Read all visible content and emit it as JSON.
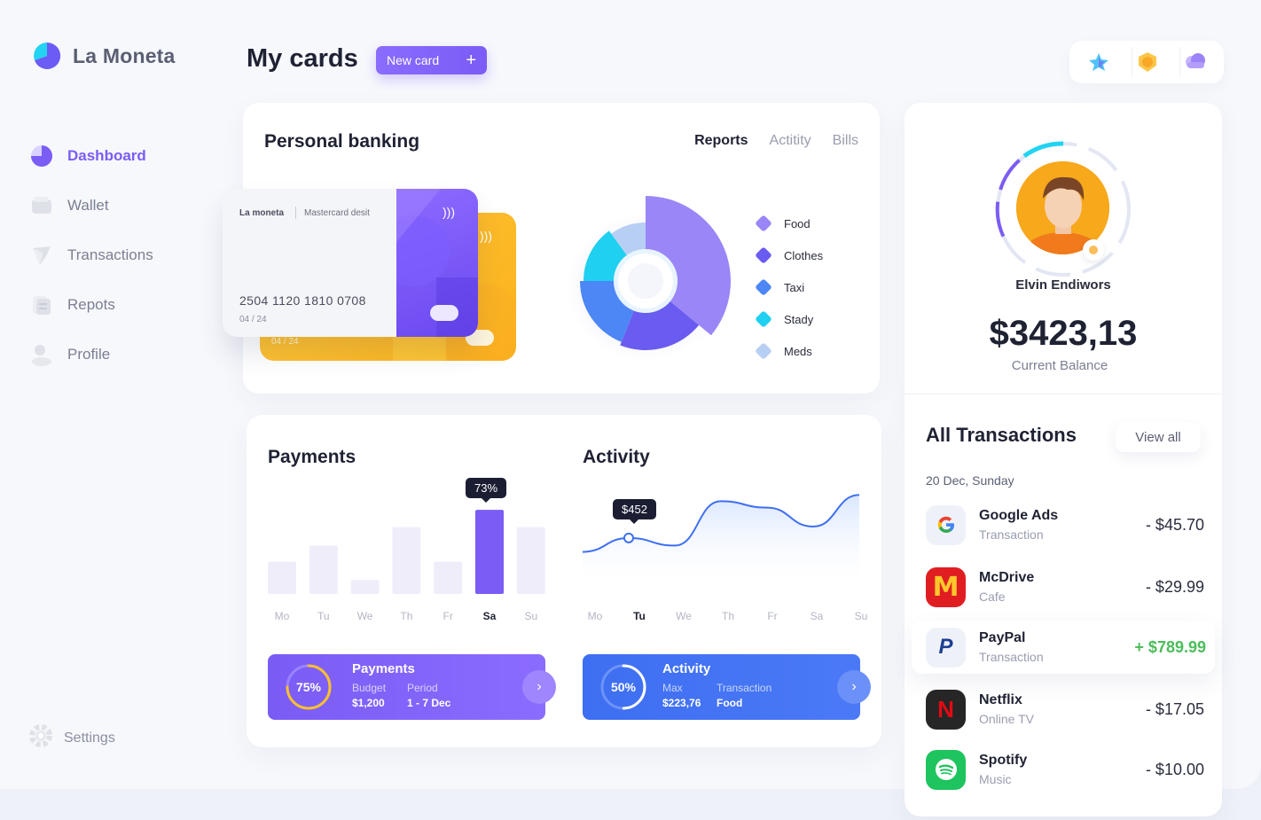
{
  "app": {
    "name": "La Moneta"
  },
  "sidebar": {
    "items": [
      {
        "label": "Dashboard",
        "icon": "pie-icon",
        "active": true
      },
      {
        "label": "Wallet",
        "icon": "wallet-icon"
      },
      {
        "label": "Transactions",
        "icon": "transactions-icon"
      },
      {
        "label": "Repots",
        "icon": "reports-icon"
      },
      {
        "label": "Profile",
        "icon": "profile-icon"
      }
    ],
    "settings_label": "Settings"
  },
  "header": {
    "title": "My cards",
    "new_card_label": "New card"
  },
  "top_icons": [
    "sparkle-icon",
    "badge-icon",
    "cloud-icon"
  ],
  "banking": {
    "title": "Personal banking",
    "tabs": [
      "Reports",
      "Actitity",
      "Bills"
    ],
    "card": {
      "brand": "La moneta",
      "type": "Mastercard desit",
      "number": "2504 1120 1810 0708",
      "expiry": "04 / 24"
    },
    "back_card_expiry": "04 / 24",
    "legend": [
      {
        "label": "Food",
        "color": "#9b86f7"
      },
      {
        "label": "Clothes",
        "color": "#6a5cf0"
      },
      {
        "label": "Taxi",
        "color": "#4d86f5"
      },
      {
        "label": "Stady",
        "color": "#1fd0f0"
      },
      {
        "label": "Meds",
        "color": "#b8cff4"
      }
    ]
  },
  "profile": {
    "name": "Elvin Endiwors",
    "balance": "$3423,13",
    "balance_label": "Current Balance"
  },
  "transactions": {
    "title": "All Transactions",
    "view_all": "View all",
    "date": "20 Dec, Sunday",
    "items": [
      {
        "name": "Google Ads",
        "sub": "Transaction",
        "amount": "- $45.70",
        "logo": "google-icon"
      },
      {
        "name": "McDrive",
        "sub": "Cafe",
        "amount": "- $29.99",
        "logo": "mcdonalds-icon"
      },
      {
        "name": "PayPal",
        "sub": "Transaction",
        "amount": "+ $789.99",
        "logo": "paypal-icon"
      },
      {
        "name": "Netflix",
        "sub": "Online TV",
        "amount": "- $17.05",
        "logo": "netflix-icon"
      },
      {
        "name": "Spotify",
        "sub": "Music",
        "amount": "- $10.00",
        "logo": "spotify-icon"
      }
    ]
  },
  "payments": {
    "title": "Payments",
    "days": [
      "Mo",
      "Tu",
      "We",
      "Th",
      "Fr",
      "Sa",
      "Su"
    ],
    "active_day": "Sa",
    "tooltip": "73%",
    "summary": {
      "title": "Payments",
      "percent": "75%",
      "budget_label": "Budget",
      "budget_value": "$1,200",
      "period_label": "Period",
      "period_value": "1 - 7 Dec"
    }
  },
  "activity": {
    "title": "Activity",
    "days": [
      "Mo",
      "Tu",
      "We",
      "Th",
      "Fr",
      "Sa",
      "Su"
    ],
    "active_day": "Tu",
    "tooltip": "$452",
    "summary": {
      "title": "Activity",
      "percent": "50%",
      "max_label": "Max",
      "max_value": "$223,76",
      "tx_label": "Transaction",
      "tx_value": "Food"
    }
  },
  "chart_data": [
    {
      "type": "pie",
      "categories": [
        "Food",
        "Clothes",
        "Taxi",
        "Stady",
        "Meds"
      ],
      "values": [
        36,
        20,
        19,
        15,
        10
      ]
    },
    {
      "type": "bar",
      "categories": [
        "Mo",
        "Tu",
        "We",
        "Th",
        "Fr",
        "Sa",
        "Su"
      ],
      "values": [
        28,
        42,
        12,
        58,
        28,
        73,
        58
      ],
      "ylim": [
        0,
        100
      ]
    },
    {
      "type": "area",
      "categories": [
        "Mo",
        "Tu",
        "We",
        "Th",
        "Fr",
        "Sa",
        "Su"
      ],
      "values": [
        430,
        452,
        440,
        510,
        500,
        470,
        520
      ]
    }
  ]
}
